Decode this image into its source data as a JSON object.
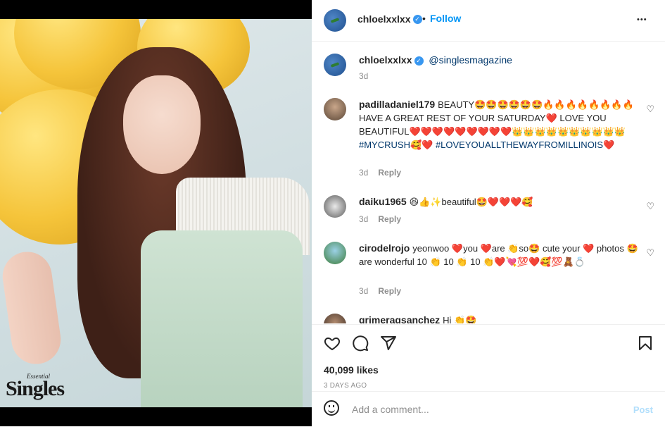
{
  "post": {
    "username": "chloelxxlxx",
    "follow_label": "Follow",
    "dot": "•",
    "more": "•••",
    "watermark_top": "Essential",
    "watermark": "Singles"
  },
  "caption": {
    "username": "chloelxxlxx",
    "text": "@singlesmagazine",
    "age": "3d"
  },
  "comments": [
    {
      "username": "padilladaniel179",
      "text": "BEAUTY🤩🤩🤩🤩🤩🤩🔥🔥🔥🔥🔥🔥🔥🔥 HAVE A GREAT REST OF YOUR SATURDAY❤️ LOVE YOU BEAUTIFUL❤️❤️❤️❤️❤️❤️❤️❤️❤️👑👑👑👑👑👑👑👑👑👑 ",
      "tags": "#MYCRUSH🥰❤️ #LOVEYOUALLTHEWAYFROMILLINOIS❤️",
      "age": "3d",
      "reply": "Reply"
    },
    {
      "username": "daiku1965",
      "text": "😆👍✨beautiful🤩❤️❤️❤️🥰",
      "tags": "",
      "age": "3d",
      "reply": "Reply"
    },
    {
      "username": "cirodelrojo",
      "text": "yeonwoo ❤️you ❤️are 👏so🤩 cute your ❤️ photos 🤩are wonderful 10 👏 10 👏 10 👏❤️💘💯❤️🥰💯🧸💍",
      "tags": "",
      "age": "3d",
      "reply": "Reply"
    },
    {
      "username": "grimeragsanchez",
      "text": "Hi 👏🤩",
      "tags": "",
      "age": "",
      "reply": ""
    }
  ],
  "likes": "40,099 likes",
  "timestamp": "3 DAYS AGO",
  "add_comment": {
    "placeholder": "Add a comment...",
    "post_label": "Post"
  },
  "colors": {
    "link": "#0095f6",
    "hashtag": "#00376b",
    "muted": "#8e8e8e"
  }
}
